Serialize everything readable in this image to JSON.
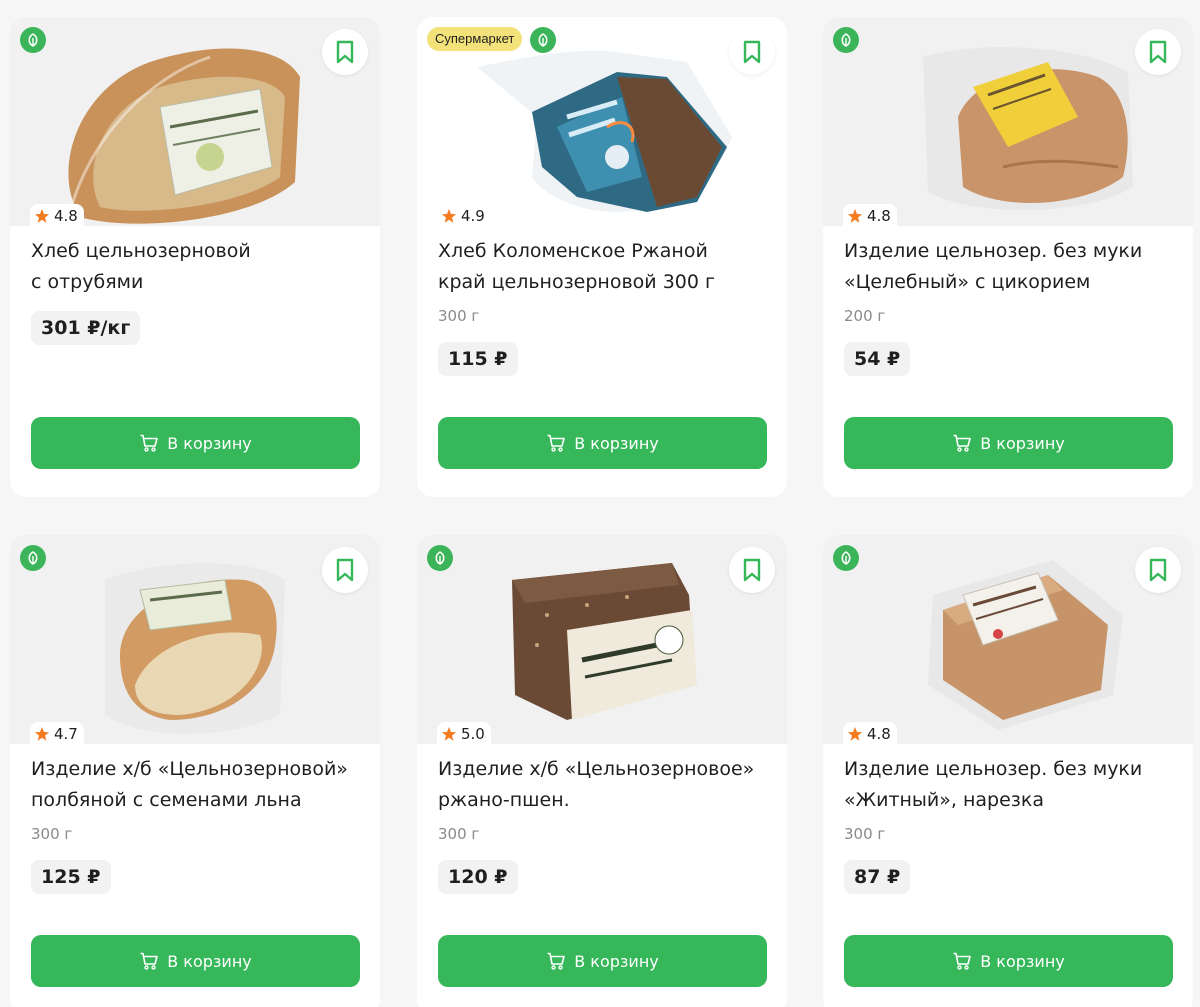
{
  "accent_color": "#35b75a",
  "rating_star_color": "#f47b20",
  "market_badge_label": "Супермаркет",
  "products": [
    {
      "title_line1": "Хлеб цельнозерновой",
      "title_line2": "с отрубями",
      "weight": "",
      "price": "301 ₽/кг",
      "rating": "4.8",
      "cart_label": "В корзину",
      "icons": [
        "eco-leaf-icon",
        "bookmark-icon",
        "star-icon",
        "cart-icon"
      ]
    },
    {
      "title_line1": "Хлеб Коломенское Ржаной",
      "title_line2": "край цельнозерновой 300 г",
      "weight": "300 г",
      "price": "115 ₽",
      "rating": "4.9",
      "cart_label": "В корзину",
      "badge": "Супермаркет"
    },
    {
      "title_line1": "Изделие цельнозер. без муки",
      "title_line2": "«Целебный» с цикорием",
      "weight": "200 г",
      "price": "54 ₽",
      "rating": "4.8",
      "cart_label": "В корзину"
    },
    {
      "title_line1": "Изделие х/б «Цельнозерновой»",
      "title_line2": "полбяной с семенами льна",
      "weight": "300 г",
      "price": "125 ₽",
      "rating": "4.7",
      "cart_label": "В корзину"
    },
    {
      "title_line1": "Изделие х/б «Цельнозерновое»",
      "title_line2": "ржано-пшен.",
      "weight": "300 г",
      "price": "120 ₽",
      "rating": "5.0",
      "cart_label": "В корзину"
    },
    {
      "title_line1": "Изделие цельнозер. без муки",
      "title_line2": "«Житный», нарезка",
      "weight": "300 г",
      "price": "87 ₽",
      "rating": "4.8",
      "cart_label": "В корзину"
    }
  ]
}
